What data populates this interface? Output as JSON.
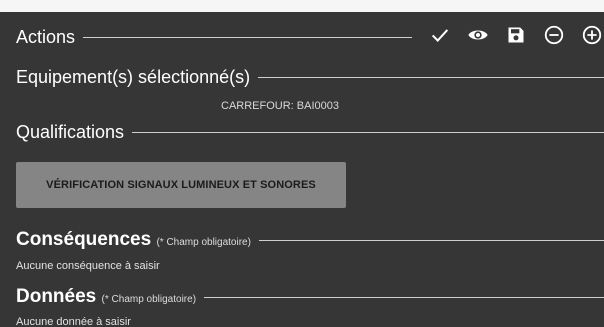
{
  "actions": {
    "title": "Actions",
    "icons": [
      "check-icon",
      "eye-icon",
      "save-icon",
      "minus-circle-icon",
      "plus-circle-icon"
    ]
  },
  "equipment": {
    "title": "Equipement(s) sélectionné(s)",
    "selected": "CARREFOUR: BAI0003"
  },
  "qualifications": {
    "title": "Qualifications",
    "button_label": "VÉRIFICATION SIGNAUX LUMINEUX ET SONORES"
  },
  "consequences": {
    "title": "Conséquences",
    "note": "(* Champ obligatoire)",
    "empty_text": "Aucune conséquence à saisir"
  },
  "donnees": {
    "title": "Données",
    "note": "(* Champ obligatoire)",
    "empty_text": "Aucune donnée à saisir"
  },
  "colors": {
    "background": "#363636",
    "button": "#858585",
    "text": "#ffffff"
  }
}
